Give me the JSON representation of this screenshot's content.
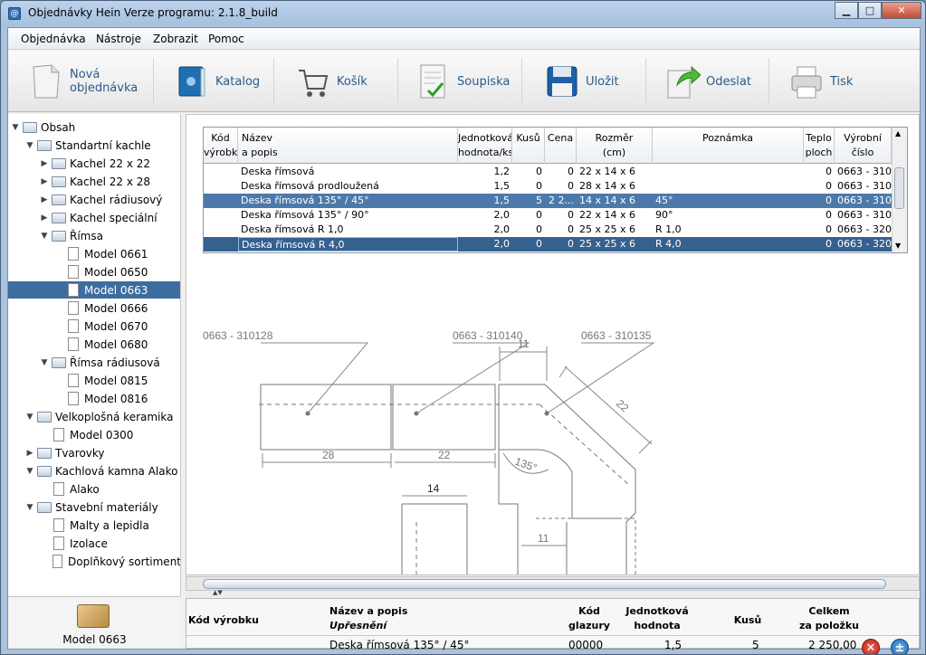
{
  "window": {
    "title": "Objednávky Hein   Verze programu: 2.1.8_build",
    "app_icon": "app-logo-icon",
    "controls": {
      "minimize": "▁",
      "maximize": "□",
      "close": "✕"
    }
  },
  "menu": [
    "Objednávka",
    "Nástroje",
    "Zobrazit",
    "Pomoc"
  ],
  "toolbar": [
    {
      "label": "Nová\nobjednávka",
      "icon": "new-document-icon"
    },
    {
      "label": "Katalog",
      "icon": "catalog-book-icon"
    },
    {
      "label": "Košík",
      "icon": "shopping-cart-icon"
    },
    {
      "label": "Soupiska",
      "icon": "checklist-icon"
    },
    {
      "label": "Uložit",
      "icon": "floppy-disk-icon"
    },
    {
      "label": "Odeslat",
      "icon": "send-arrow-icon"
    },
    {
      "label": "Tisk",
      "icon": "printer-icon"
    }
  ],
  "tree": [
    {
      "label": "Obsah",
      "level": 0,
      "type": "folder",
      "toggle": "▼"
    },
    {
      "label": "Standartní kachle",
      "level": 1,
      "type": "folder",
      "toggle": "▼"
    },
    {
      "label": "Kachel 22 x 22",
      "level": 2,
      "type": "folder",
      "toggle": "▶"
    },
    {
      "label": "Kachel 22 x 28",
      "level": 2,
      "type": "folder",
      "toggle": "▶"
    },
    {
      "label": "Kachel rádiusový",
      "level": 2,
      "type": "folder",
      "toggle": "▶"
    },
    {
      "label": "Kachel speciální",
      "level": 2,
      "type": "folder",
      "toggle": "▶"
    },
    {
      "label": "Římsa",
      "level": 2,
      "type": "folder",
      "toggle": "▼"
    },
    {
      "label": "Model 0661",
      "level": 3,
      "type": "doc",
      "toggle": ""
    },
    {
      "label": "Model 0650",
      "level": 3,
      "type": "doc",
      "toggle": ""
    },
    {
      "label": "Model 0663",
      "level": 3,
      "type": "doc",
      "toggle": "",
      "selected": true
    },
    {
      "label": "Model 0666",
      "level": 3,
      "type": "doc",
      "toggle": ""
    },
    {
      "label": "Model 0670",
      "level": 3,
      "type": "doc",
      "toggle": ""
    },
    {
      "label": "Model 0680",
      "level": 3,
      "type": "doc",
      "toggle": ""
    },
    {
      "label": "Římsa rádiusová",
      "level": 2,
      "type": "folder",
      "toggle": "▼"
    },
    {
      "label": "Model 0815",
      "level": 3,
      "type": "doc",
      "toggle": ""
    },
    {
      "label": "Model 0816",
      "level": 3,
      "type": "doc",
      "toggle": ""
    },
    {
      "label": "Velkoplošná keramika",
      "level": 1,
      "type": "folder",
      "toggle": "▼"
    },
    {
      "label": "Model 0300",
      "level": 2,
      "type": "doc",
      "toggle": ""
    },
    {
      "label": "Tvarovky",
      "level": 1,
      "type": "folder",
      "toggle": "▶"
    },
    {
      "label": "Kachlová kamna Alako",
      "level": 1,
      "type": "folder",
      "toggle": "▼"
    },
    {
      "label": "Alako",
      "level": 2,
      "type": "doc",
      "toggle": ""
    },
    {
      "label": "Stavební materiály",
      "level": 1,
      "type": "folder",
      "toggle": "▼"
    },
    {
      "label": "Malty a lepidla",
      "level": 2,
      "type": "doc",
      "toggle": ""
    },
    {
      "label": "Izolace",
      "level": 2,
      "type": "doc",
      "toggle": ""
    },
    {
      "label": "Doplňkový sortiment",
      "level": 2,
      "type": "doc",
      "toggle": ""
    }
  ],
  "preview": {
    "label": "Model 0663",
    "icon": "tile-brick-icon"
  },
  "grid": {
    "columns": [
      {
        "key": "kod",
        "label": "Kód\nvýrobku"
      },
      {
        "key": "nazev",
        "label": "Název\na popis"
      },
      {
        "key": "jc",
        "label": "Jednotková\nhodnota/ks"
      },
      {
        "key": "kusu",
        "label": "Kusů"
      },
      {
        "key": "cena",
        "label": "Cena"
      },
      {
        "key": "rozmer",
        "label": "Rozměr\n(cm)"
      },
      {
        "key": "pozn",
        "label": "Poznámka"
      },
      {
        "key": "teplo",
        "label": "Teplo\nploch"
      },
      {
        "key": "vyr",
        "label": "Výrobní\nčíslo"
      }
    ],
    "rows": [
      {
        "kod": "",
        "nazev": "Deska římsová",
        "jc": "1,2",
        "kusu": "0",
        "cena": "0",
        "rozmer": "22 x 14 x 6",
        "pozn": "",
        "teplo": "0",
        "vyr": "0663 - 310..."
      },
      {
        "kod": "",
        "nazev": "Deska římsová prodloužená",
        "jc": "1,5",
        "kusu": "0",
        "cena": "0",
        "rozmer": "28 x 14 x 6",
        "pozn": "",
        "teplo": "0",
        "vyr": "0663 - 310..."
      },
      {
        "kod": "",
        "nazev": "Deska římsová 135° / 45°",
        "jc": "1,5",
        "kusu": "5",
        "cena": "2 2...",
        "rozmer": "14 x 14 x 6",
        "pozn": "45°",
        "teplo": "0",
        "vyr": "0663 - 310...",
        "state": "sel"
      },
      {
        "kod": "",
        "nazev": "Deska římsová 135° / 90°",
        "jc": "2,0",
        "kusu": "0",
        "cena": "0",
        "rozmer": "22 x 14 x 6",
        "pozn": "90°",
        "teplo": "0",
        "vyr": "0663 - 310..."
      },
      {
        "kod": "",
        "nazev": "Deska římsová R 1,0",
        "jc": "2,0",
        "kusu": "0",
        "cena": "0",
        "rozmer": "25 x 25 x 6",
        "pozn": "R 1,0",
        "teplo": "0",
        "vyr": "0663 - 320..."
      },
      {
        "kod": "",
        "nazev": "Deska římsová R 4,0",
        "jc": "2,0",
        "kusu": "0",
        "cena": "0",
        "rozmer": "25 x 25 x 6",
        "pozn": "R 4,0",
        "teplo": "0",
        "vyr": "0663 - 320...",
        "state": "sel2"
      }
    ],
    "scroll_up": "▲",
    "scroll_down": "▼"
  },
  "drawing": {
    "callouts": [
      "0663 - 310128",
      "0663 - 310140",
      "0663 - 310135"
    ],
    "dims": [
      "11",
      "22",
      "28",
      "22",
      "135°",
      "14",
      "11"
    ]
  },
  "split_arrows": "▲▼",
  "detail": {
    "headers": {
      "kod": "Kód výrobku",
      "nazev": "Název a popis",
      "upresneni": "Upřesnění",
      "kod_glazury": "Kód\nglazury",
      "jednotkova": "Jednotková\nhodnota",
      "kusu": "Kusů",
      "celkem": "Celkem\nza položku"
    },
    "values": {
      "kod": "",
      "nazev": "Deska římsová 135° / 45°",
      "kod_glazury": "00000",
      "jednotkova": "1,5",
      "kusu": "5",
      "celkem": "2 250,00"
    },
    "delete_icon": "✕",
    "add_icon": "±"
  }
}
